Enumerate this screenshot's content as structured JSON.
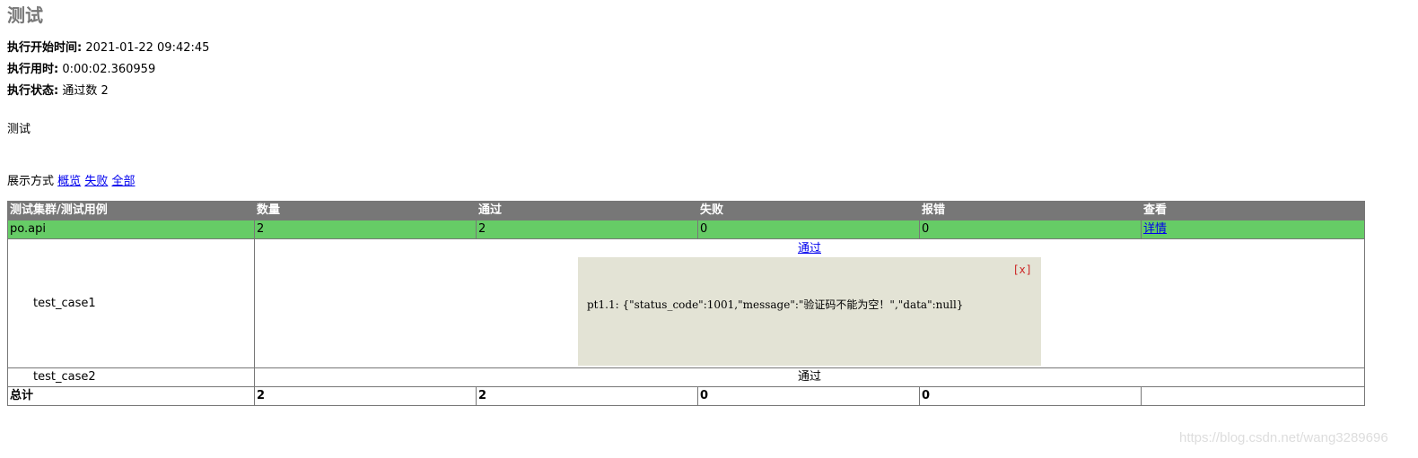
{
  "report": {
    "title": "测试",
    "start_time_label": "执行开始时间:",
    "start_time": "2021-01-22 09:42:45",
    "duration_label": "执行用时:",
    "duration": "0:00:02.360959",
    "status_label": "执行状态:",
    "status": "通过数 2",
    "description": "测试"
  },
  "display": {
    "label": "展示方式",
    "links": [
      "概览",
      "失败",
      "全部"
    ]
  },
  "table": {
    "headers": [
      "测试集群/测试用例",
      "数量",
      "通过",
      "失败",
      "报错",
      "查看"
    ],
    "suite": {
      "name": "po.api",
      "count": "2",
      "pass": "2",
      "fail": "0",
      "error": "0",
      "detail_link": "详情"
    },
    "cases": [
      {
        "name": "test_case1",
        "result": "通过",
        "popup_close": "[x]",
        "popup_log": "pt1.1: {\"status_code\":1001,\"message\":\"验证码不能为空！\",\"data\":null}"
      },
      {
        "name": "test_case2",
        "result": "通过"
      }
    ],
    "total": {
      "label": "总计",
      "count": "2",
      "pass": "2",
      "fail": "0",
      "error": "0"
    }
  },
  "watermark": "https://blog.csdn.net/wang3289696"
}
